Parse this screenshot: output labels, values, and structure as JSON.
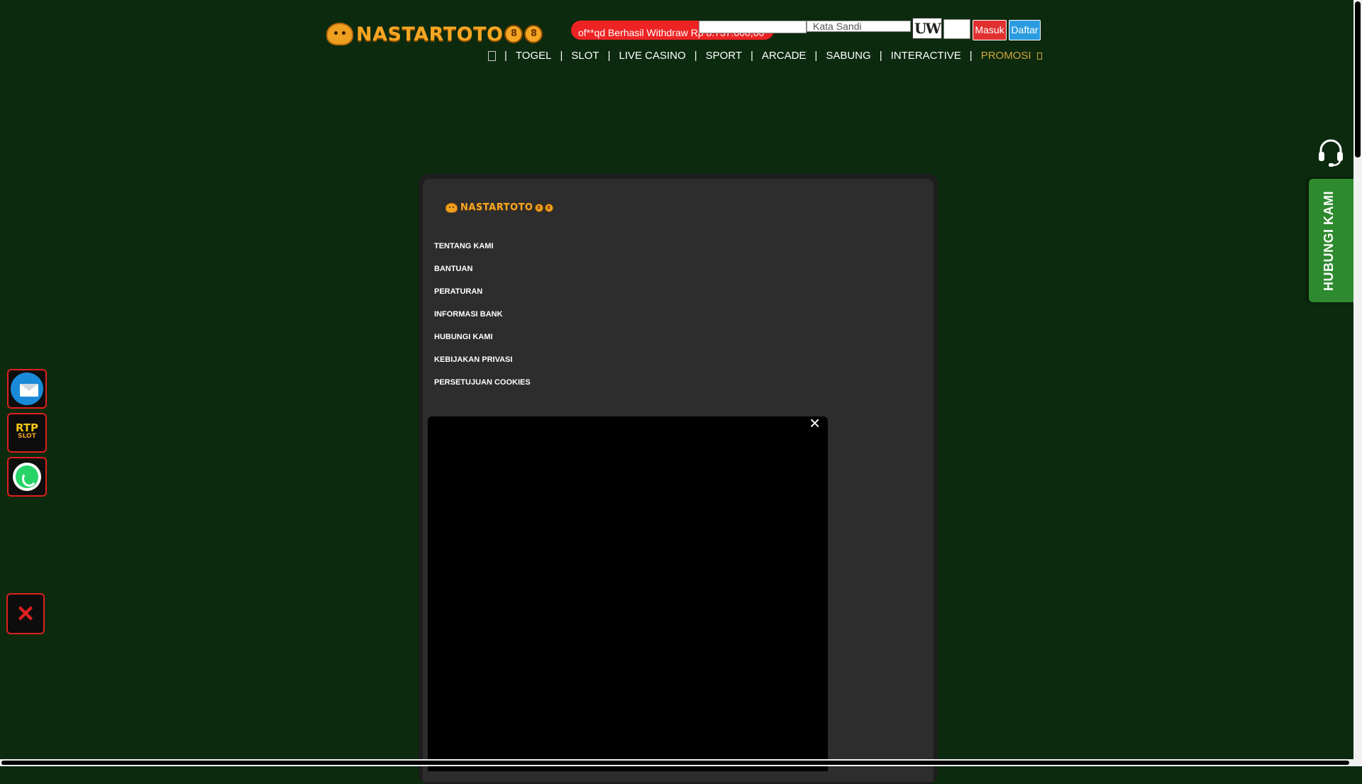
{
  "header": {
    "logo_text": "NASTARTOTO",
    "logo_num_1": "8",
    "logo_num_2": "8",
    "marquee": "of**qd Berhasil Withdraw Rp 8.737.000,00",
    "password_placeholder": "Kata Sandi",
    "captcha_text": "UW",
    "login_label": "Masuk",
    "register_label": "Daftar"
  },
  "nav": {
    "items": [
      "TOGEL",
      "SLOT",
      "LIVE CASINO",
      "SPORT",
      "ARCADE",
      "SABUNG",
      "INTERACTIVE"
    ],
    "promo": "PROMOSI",
    "separator": "|"
  },
  "panel": {
    "logo_text": "NASTARTOTO",
    "menu": [
      "TENTANG KAMI",
      "BANTUAN",
      "PERATURAN",
      "INFORMASI BANK",
      "HUBUNGI KAMI",
      "KEBIJAKAN PRIVASI",
      "PERSETUJUAN COOKIES"
    ],
    "video_close": "×"
  },
  "contact": {
    "label": "HUBUNGI KAMI"
  },
  "floating": {
    "rtp_top": "RTP",
    "rtp_bottom": "SLOT",
    "close": "✕"
  },
  "colors": {
    "background": "#0c2a0e",
    "accent_gold": "#f5a623",
    "login_red": "#e03030",
    "register_blue": "#2b9ce0",
    "contact_green": "#2e8a2f"
  },
  "icons": [
    "home-icon",
    "headset-icon",
    "mail-icon",
    "rtp-slot-icon",
    "whatsapp-icon",
    "close-icon"
  ]
}
